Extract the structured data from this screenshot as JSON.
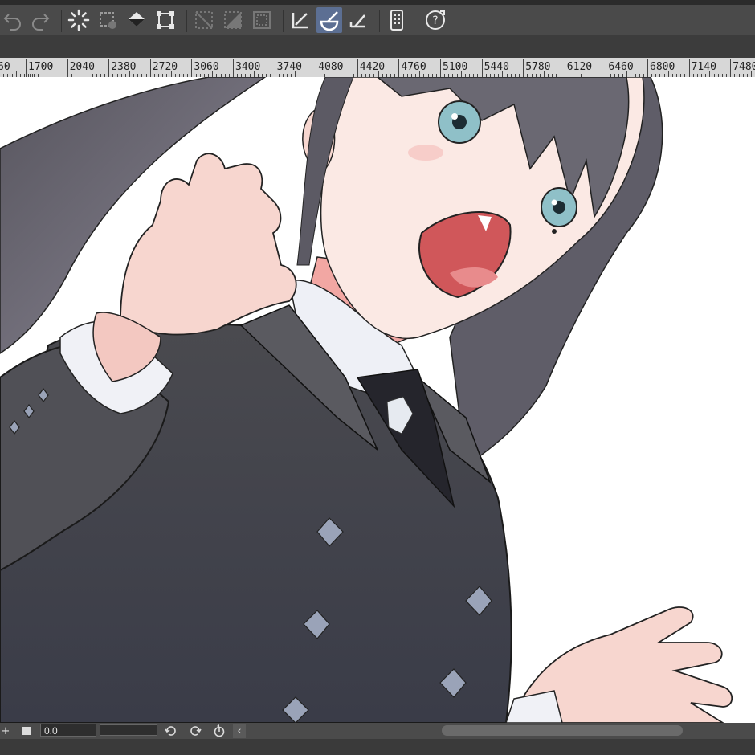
{
  "toolbar": {
    "buttons": [
      {
        "name": "undo-icon"
      },
      {
        "name": "redo-icon"
      },
      {
        "name": "loading-spinner-icon"
      },
      {
        "name": "clear-selection-icon"
      },
      {
        "name": "fill-icon"
      },
      {
        "name": "transform-icon"
      },
      {
        "name": "select-all-icon"
      },
      {
        "name": "invert-selection-icon"
      },
      {
        "name": "show-selection-icon"
      },
      {
        "name": "ruler-pen-icon"
      },
      {
        "name": "brush-icon"
      },
      {
        "name": "line-tool-icon"
      },
      {
        "name": "device-icon"
      },
      {
        "name": "help-icon"
      }
    ],
    "active_button": "brush-icon",
    "accent_color": "#5c6f93"
  },
  "ruler": {
    "labels": [
      "60",
      "1700",
      "2040",
      "2380",
      "2720",
      "3060",
      "3400",
      "3740",
      "4080",
      "4420",
      "4760",
      "5100",
      "5440",
      "5780",
      "6120",
      "6460",
      "6800",
      "7140",
      "7480"
    ]
  },
  "bottombar": {
    "zoom_value": "0.0",
    "buttons": [
      "zoom-in-icon",
      "stop-icon",
      "rotate-left-icon",
      "rotate-right-icon",
      "reset-rotation-icon",
      "collapse-icon"
    ]
  },
  "canvas": {
    "content": "illustration",
    "background_color": "#ffffff"
  }
}
